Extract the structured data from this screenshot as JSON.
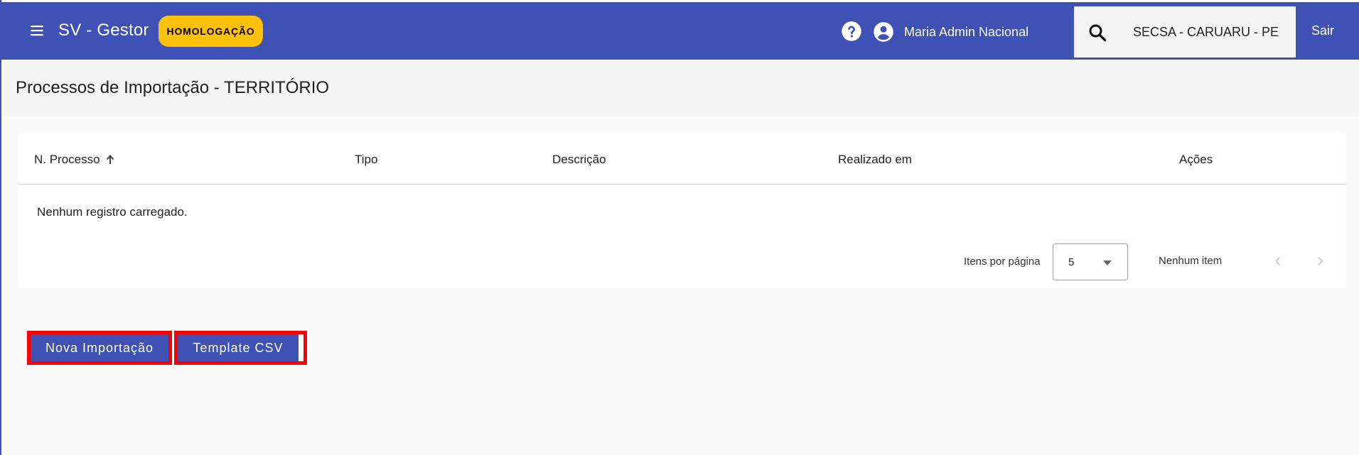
{
  "toolbar": {
    "app_title": "SV - Gestor",
    "env_badge": "HOMOLOGAÇÃO",
    "user_name": "Maria Admin Nacional",
    "search_value": "SECSA - CARUARU - PE",
    "logout_label": "Sair",
    "icons": [
      "menu-icon",
      "help-icon",
      "account-circle-icon",
      "search-icon"
    ],
    "colors": {
      "primary": "#3f51b5",
      "badge": "#ffc107"
    }
  },
  "page": {
    "title": "Processos de Importação - TERRITÓRIO"
  },
  "table": {
    "columns": [
      "N. Processo",
      "Tipo",
      "Descrição",
      "Realizado em",
      "Ações"
    ],
    "sorted_column": "N. Processo",
    "sort_direction": "ascending",
    "empty_message": "Nenhum registro carregado.",
    "rows": []
  },
  "paginator": {
    "items_per_page_label": "Itens por página",
    "page_size": "5",
    "range_label": "Nenhum item"
  },
  "actions": {
    "new_import_label": "Nova Importação",
    "template_csv_label": "Template CSV",
    "highlight_color": "#ff0000"
  }
}
